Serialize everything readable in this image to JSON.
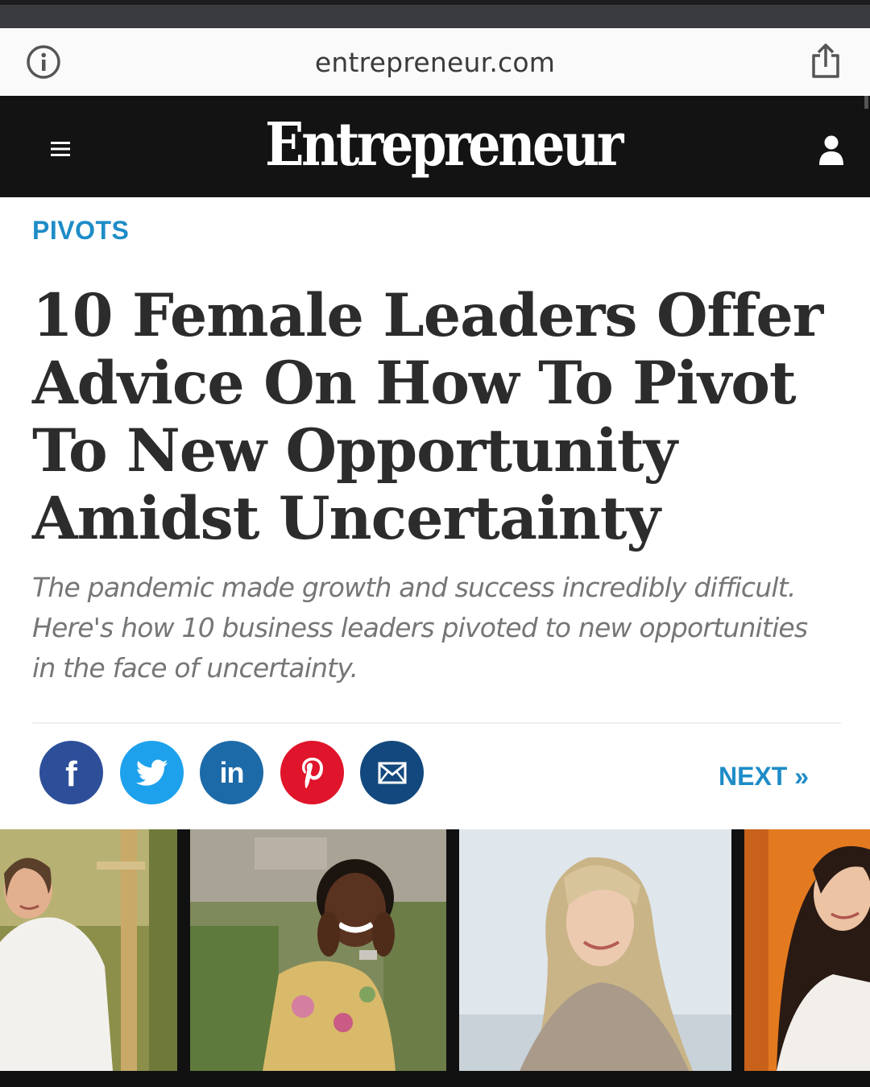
{
  "browser": {
    "url": "entrepreneur.com"
  },
  "site": {
    "logo_text": "Entrepreneur"
  },
  "article": {
    "category": "PIVOTS",
    "headline_lines": [
      "10 Female Leaders Offer",
      "Advice On How To Pivot",
      "To New Opportunity",
      "Amidst Uncertainty"
    ],
    "subhead_lines": [
      "The pandemic made growth and success incredibly difficult.",
      "Here's how 10 business leaders pivoted to new opportunities",
      "in the face of uncertainty."
    ]
  },
  "share": {
    "buttons": [
      {
        "name": "facebook",
        "icon": "facebook-icon",
        "color": "#2d4f9a"
      },
      {
        "name": "twitter",
        "icon": "twitter-bird-icon",
        "color": "#1ea1ec"
      },
      {
        "name": "linkedin",
        "icon": "linkedin-icon",
        "color": "#1d6aa8"
      },
      {
        "name": "pinterest",
        "icon": "pinterest-icon",
        "color": "#e0142a"
      },
      {
        "name": "email",
        "icon": "envelope-icon",
        "color": "#12487d"
      }
    ],
    "facebook_glyph": "f",
    "linkedin_glyph": "in",
    "next_label": "NEXT »"
  },
  "colors": {
    "accent_blue": "#1e8cc7",
    "header_bg": "#131313",
    "headline": "#2c2c2c",
    "subhead": "#767676"
  },
  "hero_image": {
    "panels": [
      "woman-in-white-shirt-outdoors",
      "woman-smiling-hands-on-cheeks",
      "blonde-woman-smiling",
      "woman-with-long-dark-hair"
    ]
  }
}
